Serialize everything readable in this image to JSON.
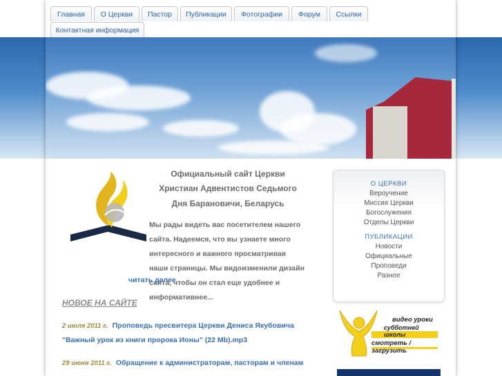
{
  "nav": {
    "tabs": [
      {
        "label": "Главная"
      },
      {
        "label": "О Церкви"
      },
      {
        "label": "Пастор"
      },
      {
        "label": "Публикации"
      },
      {
        "label": "Фотографии"
      },
      {
        "label": "Форум"
      },
      {
        "label": "Ссылки"
      },
      {
        "label": "Контактная информация"
      }
    ]
  },
  "main": {
    "title_lines": [
      "Официальный сайт Церкви",
      "Христиан Адвентистов Седьмого",
      "Дня Барановичи, Беларусь"
    ],
    "intro_first": "Мы рады видеть вас посетителем нашего сайта. Надеемся, что вы узнаете много интересного и важного просматривая наши страницы. Мы видоизменили дизайн сайта, чтобы он стал еще удобнее и информативнее...",
    "read_more": "читать далее",
    "news_heading": "НОВОЕ НА САЙТЕ",
    "news": [
      {
        "date": "2 июля 2011 г.",
        "text": "Проповедь пресвитера Церкви Дениса Якубовича \"Важный урок из книги пророка Ионы\" (22 Mb).mp3"
      },
      {
        "date": "29 июня 2011 г.",
        "text": "Обращение к администраторам, пасторам и членам"
      }
    ]
  },
  "sidebar": {
    "sections": [
      {
        "heading": "О ЦЕРКВИ",
        "items": [
          "Вероучение",
          "Миссия Церкви",
          "Богослужения",
          "Отделы Церкви"
        ]
      },
      {
        "heading": "ПУБЛИКАЦИИ",
        "items": [
          "Новости",
          "Официальные",
          "Проповеди",
          "Разное"
        ]
      }
    ]
  },
  "video_banner": {
    "line1": "видео уроки",
    "line2": "субботней школы",
    "line3": "смотреть / загрузить"
  },
  "icons": {
    "logo": "adventist-flame-logo-icon",
    "banner": "person-arms-raised-icon"
  },
  "colors": {
    "link": "#3a6fb0",
    "text": "#6b6b6b",
    "accent_red": "#a5283c",
    "banner_yellow": "#f2cf1c"
  }
}
